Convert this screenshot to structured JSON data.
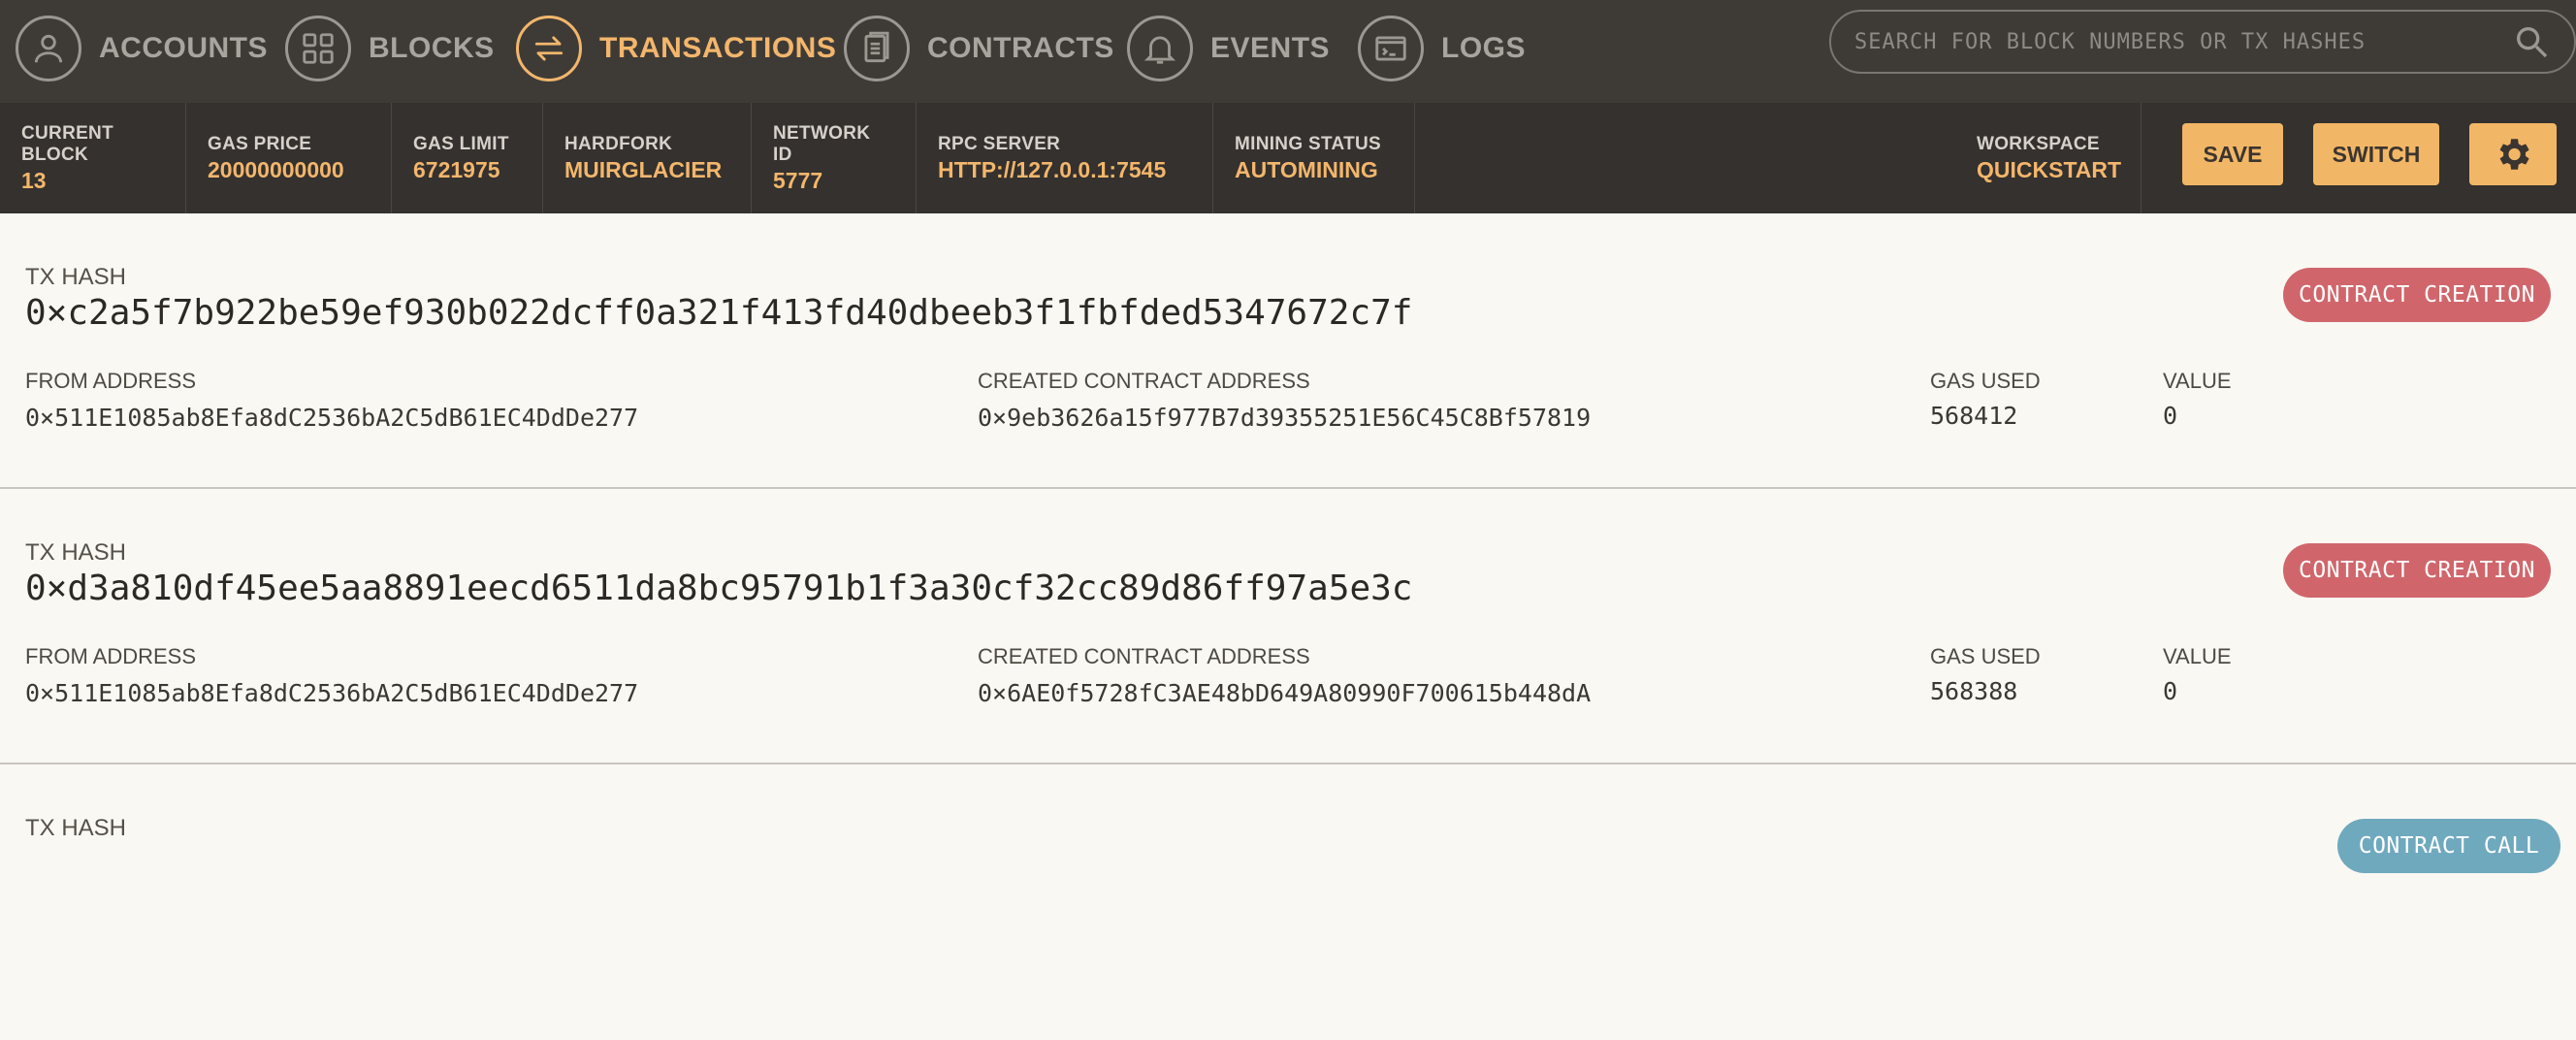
{
  "nav": {
    "items": [
      {
        "label": "ACCOUNTS",
        "icon": "user-icon"
      },
      {
        "label": "BLOCKS",
        "icon": "blocks-icon"
      },
      {
        "label": "TRANSACTIONS",
        "icon": "transactions-icon",
        "active": true
      },
      {
        "label": "CONTRACTS",
        "icon": "document-icon"
      },
      {
        "label": "EVENTS",
        "icon": "bell-icon"
      },
      {
        "label": "LOGS",
        "icon": "terminal-icon"
      }
    ],
    "search_placeholder": "SEARCH FOR BLOCK NUMBERS OR TX HASHES"
  },
  "status": {
    "current_block": {
      "label": "CURRENT BLOCK",
      "value": "13"
    },
    "gas_price": {
      "label": "GAS PRICE",
      "value": "20000000000"
    },
    "gas_limit": {
      "label": "GAS LIMIT",
      "value": "6721975"
    },
    "hardfork": {
      "label": "HARDFORK",
      "value": "MUIRGLACIER"
    },
    "network_id": {
      "label": "NETWORK ID",
      "value": "5777"
    },
    "rpc_server": {
      "label": "RPC SERVER",
      "value": "HTTP://127.0.0.1:7545"
    },
    "mining_status": {
      "label": "MINING STATUS",
      "value": "AUTOMINING"
    },
    "workspace": {
      "label": "WORKSPACE",
      "value": "QUICKSTART"
    },
    "save_label": "SAVE",
    "switch_label": "SWITCH"
  },
  "transactions": [
    {
      "hash_label": "TX HASH",
      "hash": "0×c2a5f7b922be59ef930b022dcff0a321f413fd40dbeeb3f1fbfded5347672c7f",
      "from_label": "FROM ADDRESS",
      "from": "0×511E1085ab8Efa8dC2536bA2C5dB61EC4DdDe277",
      "contract_label": "CREATED CONTRACT ADDRESS",
      "contract": "0×9eb3626a15f977B7d39355251E56C45C8Bf57819",
      "gas_label": "GAS USED",
      "gas": "568412",
      "value_label": "VALUE",
      "value": "0",
      "badge": "CONTRACT CREATION"
    },
    {
      "hash_label": "TX HASH",
      "hash": "0×d3a810df45ee5aa8891eecd6511da8bc95791b1f3a30cf32cc89d86ff97a5e3c",
      "from_label": "FROM ADDRESS",
      "from": "0×511E1085ab8Efa8dC2536bA2C5dB61EC4DdDe277",
      "contract_label": "CREATED CONTRACT ADDRESS",
      "contract": "0×6AE0f5728fC3AE48bD649A80990F700615b448dA",
      "gas_label": "GAS USED",
      "gas": "568388",
      "value_label": "VALUE",
      "value": "0",
      "badge": "CONTRACT CREATION"
    },
    {
      "hash_label": "TX HASH",
      "badge": "CONTRACT CALL"
    }
  ],
  "colors": {
    "accent": "#f3b66c",
    "nav_bg": "#3e3b37",
    "status_bg": "#34312e",
    "creation_badge": "#d0666b",
    "call_badge": "#6fa9be"
  }
}
